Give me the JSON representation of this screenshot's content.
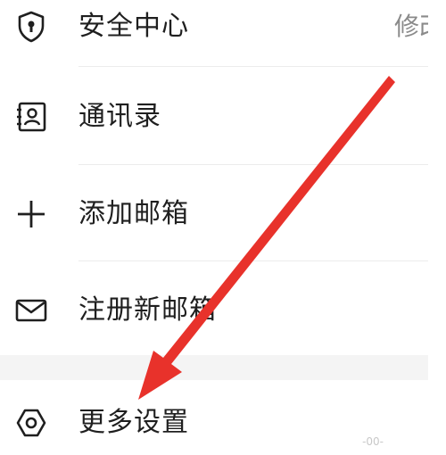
{
  "menu": {
    "items": [
      {
        "label": "安全中心",
        "trail": "修改",
        "icon": "shield-lock-icon"
      },
      {
        "label": "通讯录",
        "icon": "contacts-book-icon"
      },
      {
        "label": "添加邮箱",
        "icon": "plus-icon"
      },
      {
        "label": "注册新邮箱",
        "icon": "mail-envelope-icon"
      },
      {
        "label": "更多设置",
        "icon": "hexagon-settings-icon"
      }
    ]
  },
  "watermark": "-00-",
  "colors": {
    "arrow": "#e8322b",
    "text": "#1f1f1f",
    "divider": "#ececec",
    "icon": "#1f1f1f"
  }
}
